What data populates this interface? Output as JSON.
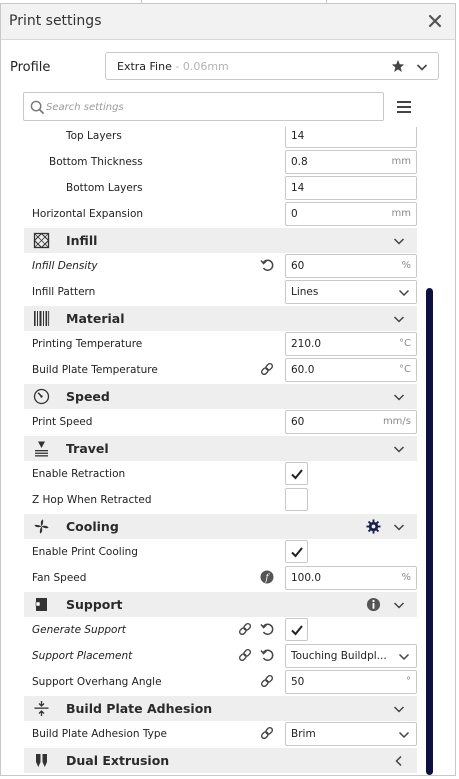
{
  "window": {
    "title": "Print settings"
  },
  "profile": {
    "label": "Profile",
    "name": "Extra Fine",
    "subtitle": " - 0.06mm"
  },
  "search": {
    "placeholder": "Search settings"
  },
  "colors": {
    "accent": "#0d1140",
    "category_bg": "#eeeeee",
    "header_bg": "#f2f2f2"
  },
  "rows": {
    "top_layers": {
      "label": "Top Layers",
      "value": "14"
    },
    "bottom_thickness": {
      "label": "Bottom Thickness",
      "value": "0.8",
      "unit": "mm"
    },
    "bottom_layers": {
      "label": "Bottom Layers",
      "value": "14"
    },
    "horizontal_expansion": {
      "label": "Horizontal Expansion",
      "value": "0",
      "unit": "mm"
    },
    "infill_density": {
      "label": "Infill Density",
      "value": "60",
      "unit": "%"
    },
    "infill_pattern": {
      "label": "Infill Pattern",
      "value": "Lines"
    },
    "printing_temperature": {
      "label": "Printing Temperature",
      "value": "210.0",
      "unit": "°C"
    },
    "build_plate_temperature": {
      "label": "Build Plate Temperature",
      "value": "60.0",
      "unit": "°C"
    },
    "print_speed": {
      "label": "Print Speed",
      "value": "60",
      "unit": "mm/s"
    },
    "enable_retraction": {
      "label": "Enable Retraction",
      "checked": true
    },
    "z_hop": {
      "label": "Z Hop When Retracted",
      "checked": false
    },
    "enable_print_cooling": {
      "label": "Enable Print Cooling",
      "checked": true
    },
    "fan_speed": {
      "label": "Fan Speed",
      "value": "100.0",
      "unit": "%"
    },
    "generate_support": {
      "label": "Generate Support",
      "checked": true
    },
    "support_placement": {
      "label": "Support Placement",
      "value": "Touching Buildpl..."
    },
    "support_overhang_angle": {
      "label": "Support Overhang Angle",
      "value": "50",
      "unit": "°"
    },
    "build_plate_adhesion_type": {
      "label": "Build Plate Adhesion Type",
      "value": "Brim"
    }
  },
  "categories": {
    "infill": "Infill",
    "material": "Material",
    "speed": "Speed",
    "travel": "Travel",
    "cooling": "Cooling",
    "support": "Support",
    "adhesion": "Build Plate Adhesion",
    "dual_extrusion": "Dual Extrusion"
  },
  "icons": {
    "close": "close-icon",
    "star": "star-icon",
    "search": "search-icon",
    "menu": "hamburger-icon",
    "reset": "reset-icon",
    "link": "link-icon",
    "function": "function-icon",
    "gear": "gear-icon",
    "info": "info-icon"
  }
}
